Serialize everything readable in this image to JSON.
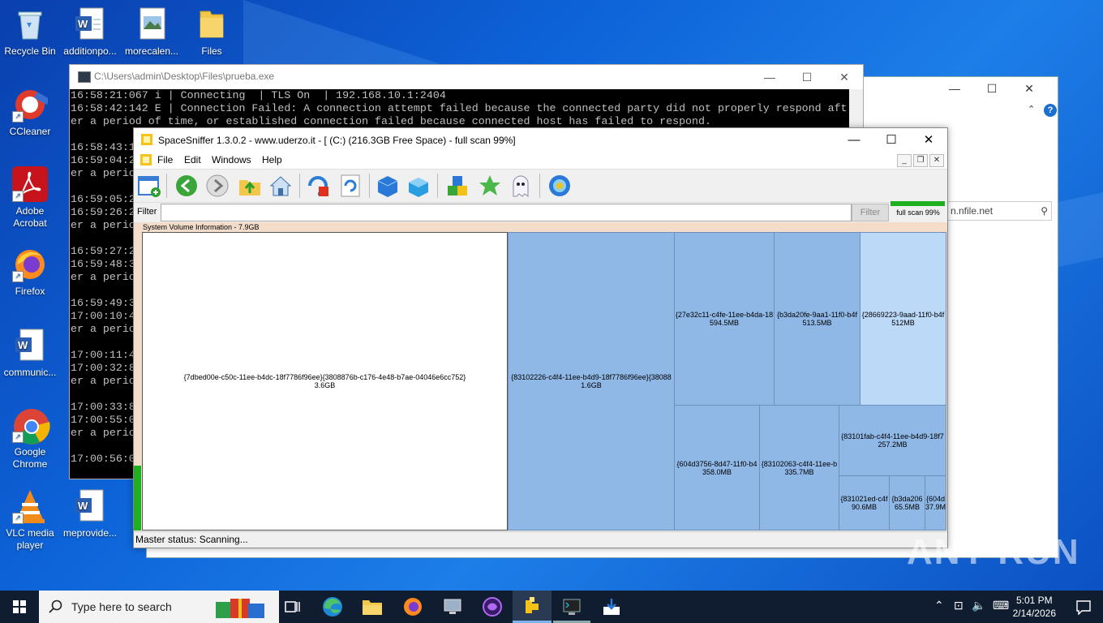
{
  "desktop": {
    "icons": [
      {
        "label": "Recycle Bin"
      },
      {
        "label": "additionpo..."
      },
      {
        "label": "morecalen..."
      },
      {
        "label": "Files"
      },
      {
        "label": "CCleaner"
      },
      {
        "label": "Adobe\nAcrobat"
      },
      {
        "label": "Firefox"
      },
      {
        "label": "communic..."
      },
      {
        "label": "Google\nChrome"
      },
      {
        "label": "VLC media\nplayer"
      },
      {
        "label": "meprovide..."
      }
    ]
  },
  "explorer_bg": {
    "search_text": "n.nfile.net",
    "help": "?"
  },
  "console": {
    "title": "C:\\Users\\admin\\Desktop\\Files\\prueba.exe",
    "lines": [
      "16:58:21:067 i | Connecting  | TLS On  | 192.168.10.1:2404",
      "16:58:42:142 E | Connection Failed: A connection attempt failed because the connected party did not properly respond aft",
      "er a period of time, or established connection failed because connected host has failed to respond.",
      "",
      "16:58:43:1",
      "16:59:04:2",
      "er a perio",
      "",
      "16:59:05:2",
      "16:59:26:2",
      "er a perio",
      "",
      "16:59:27:2",
      "16:59:48:3",
      "er a perio",
      "",
      "16:59:49:3",
      "17:00:10:4",
      "er a perio",
      "",
      "17:00:11:4",
      "17:00:32:8",
      "er a perio",
      "",
      "17:00:33:8",
      "17:00:55:0",
      "er a perio",
      "",
      "17:00:56:0"
    ]
  },
  "spacesniffer": {
    "title": "SpaceSniffer 1.3.0.2 - www.uderzo.it - [ (C:) (216.3GB Free Space) - full scan 99%]",
    "menu": {
      "file": "File",
      "edit": "Edit",
      "windows": "Windows",
      "help": "Help"
    },
    "filter_label": "Filter",
    "filter_value": "",
    "filter_button": "Filter",
    "progress": {
      "value": 0.99,
      "label": "full scan 99%"
    },
    "header": "System Volume Information - 7.9GB",
    "status": "Master status: Scanning...",
    "tiles": [
      {
        "name": "{7dbed00e-c50c-11ee-b4dc-18f7786f96ee}{3808876b-c176-4e48-b7ae-04046e6cc752}",
        "size": "3.6GB"
      },
      {
        "name": "{83102226-c4f4-11ee-b4d9-18f7786f96ee}{38088",
        "size": "1.6GB"
      },
      {
        "name": "{27e32c11-c4fe-11ee-b4da-18",
        "size": "594.5MB"
      },
      {
        "name": "{b3da20fe-9aa1-11f0-b4f",
        "size": "513.5MB"
      },
      {
        "name": "{28669223-9aad-11f0-b4f",
        "size": "512MB"
      },
      {
        "name": "{604d3756-8d47-11f0-b4",
        "size": "358.0MB"
      },
      {
        "name": "{83102063-c4f4-11ee-b",
        "size": "335.7MB"
      },
      {
        "name": "{83101fab-c4f4-11ee-b4d9-18f7",
        "size": "257.2MB"
      },
      {
        "name": "{831021ed-c4f",
        "size": "90.6MB"
      },
      {
        "name": "{b3da206",
        "size": "65.5MB"
      },
      {
        "name": "{604d",
        "size": "37.9M"
      }
    ]
  },
  "taskbar": {
    "search_placeholder": "Type here to search",
    "time": "5:01 PM",
    "date": "2/14/2026"
  },
  "watermark": "ANY RUN"
}
